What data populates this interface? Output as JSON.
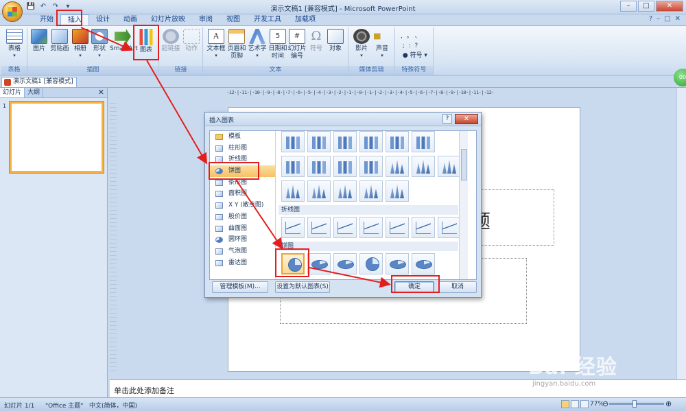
{
  "window": {
    "title": "演示文稿1 [兼容模式] - Microsoft PowerPoint",
    "controls": [
      "–",
      "□",
      "✕"
    ]
  },
  "qat": [
    "💾",
    "↶",
    "↷",
    "▾"
  ],
  "tabs": [
    "开始",
    "插入",
    "设计",
    "动画",
    "幻灯片放映",
    "审阅",
    "视图",
    "开发工具",
    "加载项"
  ],
  "active_tab": "插入",
  "help_icons": [
    "?",
    "–",
    "□",
    "✕"
  ],
  "ribbon": {
    "groups": {
      "table": "表格",
      "illustrations": "插图",
      "links": "链接",
      "text": "文本",
      "media": "媒体剪辑",
      "special": "特殊符号"
    },
    "buttons": {
      "table": "表格",
      "picture": "图片",
      "clipart": "剪贴画",
      "album": "相册",
      "shapes": "形状",
      "smartart": "SmartArt",
      "chart": "图表",
      "hyperlink": "超链接",
      "action": "动作",
      "textbox": "文本框",
      "header_l1": "页眉和",
      "header_l2": "页脚",
      "wordart": "艺术字",
      "datetime_l1": "日期和",
      "datetime_l2": "时间",
      "slidenum_l1": "幻灯片",
      "slidenum_l2": "编号",
      "symbol": "符号",
      "object": "对象",
      "movie": "影片",
      "sound": "声音",
      "special_symbols": ",  。 、\n ;  :  ?\n ● 符号 ▾"
    },
    "icon_glyphs": {
      "textbox": "A",
      "datetime": "5",
      "slidenum": "#",
      "symbol": "Ω"
    }
  },
  "doc_tab": "演示文稿1 [兼容模式]",
  "left_pane": {
    "tabs": [
      "幻灯片",
      "大纲"
    ],
    "close": "✕",
    "slide_number": "1"
  },
  "ruler": "·12·|·11·|·10·|·9·|·8·|·7·|·6·|·5·|·4·|·3·|·2·|·1·|·0·|·1·|·2·|·3·|·4·|·5·|·6·|·7·|·8·|·9·|·10·|·11·|·12·",
  "slide": {
    "title_fragment": "题"
  },
  "notes_placeholder": "单击此处添加备注",
  "status": {
    "slide": "幻灯片 1/1",
    "theme": "\"Office 主题\"",
    "language": "中文(简体，中国)",
    "zoom": "77%",
    "zoom_minus": "⊖",
    "zoom_plus": "⊕"
  },
  "dialog": {
    "title": "插入图表",
    "help": "?",
    "close": "✕",
    "categories": [
      "模板",
      "柱形图",
      "折线图",
      "饼图",
      "条形图",
      "面积图",
      "X Y (散点图)",
      "股价图",
      "曲面图",
      "圆环图",
      "气泡图",
      "雷达图"
    ],
    "selected_category": "饼图",
    "sections": {
      "line": "折线图",
      "pie": "饼图"
    },
    "buttons": {
      "manage_templates": "管理模板(M)...",
      "set_default": "设置为默认图表(S)",
      "ok": "确定",
      "cancel": "取消"
    }
  },
  "watermark": {
    "brand": "Bai 经验",
    "url": "jingyan.baidu.com"
  },
  "colors": {
    "annotation_red": "#e41e1e",
    "selection_orange": "#f6c166",
    "ribbon_blue": "#dae6f4"
  }
}
